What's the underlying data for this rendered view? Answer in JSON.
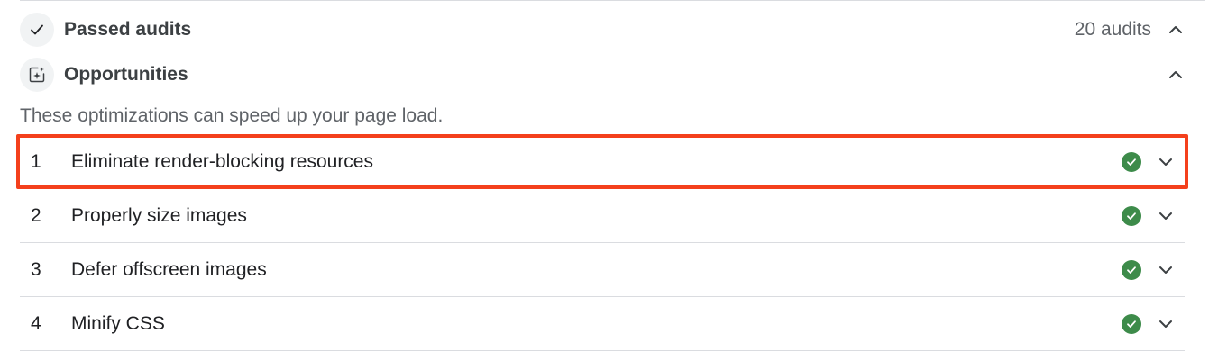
{
  "passed_audits": {
    "title": "Passed audits",
    "count_label": "20 audits",
    "icon": "checkmark-icon"
  },
  "opportunities": {
    "title": "Opportunities",
    "icon": "sparkle-page-icon",
    "description": "These optimizations can speed up your page load.",
    "items": [
      {
        "num": "1",
        "label": "Eliminate render-blocking resources",
        "highlighted": true
      },
      {
        "num": "2",
        "label": "Properly size images"
      },
      {
        "num": "3",
        "label": "Defer offscreen images"
      },
      {
        "num": "4",
        "label": "Minify CSS"
      }
    ]
  },
  "colors": {
    "pass_green": "#3d8b4a",
    "highlight_red": "#f4401c"
  }
}
